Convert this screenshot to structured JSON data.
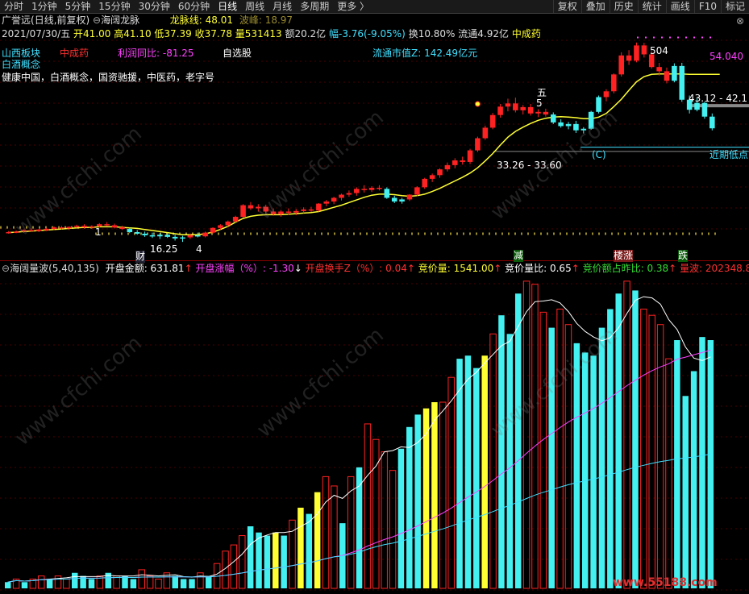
{
  "toolbar": {
    "periods": [
      "分时",
      "1分钟",
      "5分钟",
      "15分钟",
      "30分钟",
      "60分钟",
      "日线",
      "周线",
      "月线",
      "多周期",
      "更多 〉"
    ],
    "active": "日线",
    "right": [
      "复权",
      "叠加",
      "历史",
      "统计",
      "画线",
      "F10",
      "标记"
    ]
  },
  "header": {
    "stock_name": "广誉远",
    "mode": "(日线,前复权)",
    "indicator_name": "海阔龙脉",
    "longmai_label": "龙脉线:",
    "longmai_value": "48.01",
    "bofeng_label": "波峰:",
    "bofeng_value": "18.97"
  },
  "quote": {
    "date": "2021/07/30/五",
    "open": "开41.00",
    "high": "高41.10",
    "low": "低37.39",
    "close": "收37.78",
    "volume": "量531413",
    "amount": "额20.2亿",
    "change": "幅-3.76(-9.05%)",
    "turnover": "换10.80%",
    "float": "流通4.92亿",
    "industry": "中成药"
  },
  "info": {
    "region": "山西板块",
    "industry": "中成药",
    "profit_label": "利润同比: -81.25",
    "watchlist": "自选股",
    "market_cap": "流通市值Z: 142.49亿元",
    "concept": "白酒概念",
    "tags": "健康中国，白酒概念，国资驰援，中医药，老字号"
  },
  "annotations": {
    "price_high": "54.040",
    "range1": "43.12 - 42.1",
    "range2": "33.26 - 33.60",
    "low_price": "16.25",
    "recent_low": "近期低点",
    "wu": "五",
    "five": "5",
    "c_mark": "(C)",
    "cai": "财",
    "one": "1",
    "four": "4",
    "peak_text": "5",
    "peak_text2": "04",
    "jian": "减",
    "lou": "楼涨",
    "die": "跌"
  },
  "sub": {
    "name": "海阔量波(5,40,135)",
    "kaipan_jine": "开盘金额: 631.81",
    "zhangfu": "开盘涨幅（%）: -1.30",
    "huanshou": "开盘换手Z（%）: 0.04",
    "jingjia_liang": "竞价量: 1541.00",
    "liangbi": "竞价量比: 0.65",
    "jine_zhanbi": "竞价额占昨比: 0.38",
    "liangbo": "量波: 202348.80"
  },
  "watermark": "www.cfchi.com",
  "corner_logo": "www.55188.com",
  "colors": {
    "up": "#ff2222",
    "down": "#44f0f0",
    "ma": "#ffff33",
    "pink": "#ff40ff",
    "cyan": "#40e0ff"
  },
  "chart_data": {
    "type": "candlestick",
    "candles": [
      [
        18.0,
        18.3,
        17.8,
        18.1,
        0
      ],
      [
        18.1,
        18.4,
        17.9,
        18.2,
        0
      ],
      [
        18.2,
        18.6,
        18.0,
        18.5,
        0
      ],
      [
        18.5,
        18.8,
        18.2,
        18.3,
        0
      ],
      [
        18.3,
        18.7,
        18.1,
        18.6,
        0
      ],
      [
        18.6,
        18.9,
        18.3,
        18.7,
        0
      ],
      [
        18.7,
        19.2,
        18.5,
        19.0,
        0
      ],
      [
        19.0,
        19.3,
        18.6,
        18.8,
        0
      ],
      [
        18.8,
        19.2,
        18.5,
        19.1,
        0
      ],
      [
        19.1,
        19.5,
        18.9,
        19.3,
        0
      ],
      [
        19.3,
        19.6,
        18.8,
        19.0,
        0
      ],
      [
        19.0,
        19.4,
        18.7,
        19.2,
        0
      ],
      [
        19.2,
        19.8,
        19.0,
        19.6,
        0
      ],
      [
        19.6,
        20.0,
        19.2,
        19.4,
        0
      ],
      [
        19.4,
        19.7,
        18.8,
        19.0,
        0
      ],
      [
        19.0,
        19.3,
        18.5,
        18.7,
        0
      ],
      [
        18.7,
        19.0,
        17.9,
        18.1,
        1
      ],
      [
        18.1,
        18.5,
        17.6,
        17.8,
        1
      ],
      [
        17.8,
        18.2,
        17.2,
        17.5,
        1
      ],
      [
        17.5,
        18.0,
        17.0,
        17.3,
        1
      ],
      [
        17.3,
        17.9,
        16.8,
        17.6,
        1
      ],
      [
        17.6,
        18.0,
        17.0,
        17.2,
        1
      ],
      [
        17.2,
        17.6,
        16.5,
        16.9,
        1
      ],
      [
        16.9,
        17.4,
        16.25,
        17.1,
        1
      ],
      [
        17.1,
        17.8,
        16.8,
        17.5,
        0
      ],
      [
        17.5,
        18.0,
        17.1,
        17.3,
        1
      ],
      [
        17.3,
        18.2,
        17.1,
        18.0,
        0
      ],
      [
        18.0,
        19.0,
        17.8,
        18.9,
        0
      ],
      [
        18.9,
        19.6,
        18.6,
        19.4,
        0
      ],
      [
        19.4,
        20.3,
        19.0,
        20.1,
        0
      ],
      [
        20.1,
        21.2,
        19.9,
        21.0,
        0
      ],
      [
        21.0,
        23.4,
        20.8,
        23.2,
        0
      ],
      [
        23.2,
        23.8,
        22.3,
        22.6,
        0
      ],
      [
        22.6,
        23.4,
        22.0,
        22.9,
        0
      ],
      [
        22.9,
        23.3,
        21.6,
        22.0,
        0
      ],
      [
        22.0,
        22.6,
        21.2,
        21.5,
        0
      ],
      [
        21.5,
        22.3,
        21.0,
        22.0,
        0
      ],
      [
        22.0,
        22.6,
        21.4,
        21.8,
        0
      ],
      [
        21.8,
        22.5,
        21.3,
        22.1,
        0
      ],
      [
        22.1,
        22.8,
        21.7,
        22.4,
        0
      ],
      [
        22.4,
        22.9,
        21.9,
        22.2,
        0
      ],
      [
        22.2,
        23.6,
        22.0,
        23.5,
        0
      ],
      [
        23.5,
        24.2,
        23.0,
        23.9,
        0
      ],
      [
        23.9,
        24.8,
        23.4,
        24.6,
        0
      ],
      [
        24.6,
        25.4,
        24.1,
        25.2,
        0
      ],
      [
        25.2,
        26.0,
        24.8,
        25.5,
        0
      ],
      [
        25.5,
        26.6,
        25.0,
        26.3,
        0
      ],
      [
        26.3,
        27.0,
        25.6,
        26.1,
        0
      ],
      [
        26.1,
        26.8,
        25.7,
        26.5,
        0
      ],
      [
        26.5,
        27.0,
        26.0,
        26.3,
        0
      ],
      [
        26.3,
        26.6,
        24.4,
        24.6,
        1
      ],
      [
        24.6,
        25.0,
        23.6,
        23.9,
        1
      ],
      [
        23.9,
        24.6,
        23.5,
        24.3,
        1
      ],
      [
        24.3,
        25.3,
        24.0,
        25.2,
        0
      ],
      [
        25.2,
        26.8,
        24.9,
        26.6,
        0
      ],
      [
        26.6,
        28.4,
        26.3,
        28.2,
        0
      ],
      [
        28.2,
        29.2,
        27.6,
        28.9,
        0
      ],
      [
        28.9,
        30.2,
        28.4,
        30.0,
        0
      ],
      [
        30.0,
        31.3,
        29.6,
        30.8,
        0
      ],
      [
        30.8,
        32.1,
        30.2,
        31.7,
        0
      ],
      [
        31.7,
        32.4,
        30.9,
        31.4,
        0
      ],
      [
        31.4,
        33.9,
        31.0,
        33.6,
        0
      ],
      [
        33.6,
        36.2,
        33.3,
        35.9,
        0
      ],
      [
        35.9,
        38.3,
        35.6,
        37.9,
        0
      ],
      [
        37.9,
        40.7,
        37.6,
        40.3,
        0
      ],
      [
        40.3,
        42.4,
        39.8,
        41.9,
        0
      ],
      [
        41.9,
        43.4,
        41.0,
        42.5,
        0
      ],
      [
        42.5,
        43.6,
        40.8,
        41.2,
        0
      ],
      [
        41.2,
        42.2,
        40.4,
        41.8,
        0
      ],
      [
        41.8,
        42.4,
        40.2,
        40.6,
        0
      ],
      [
        40.6,
        41.4,
        39.9,
        40.9,
        0
      ],
      [
        40.9,
        41.5,
        40.0,
        40.4,
        0
      ],
      [
        40.4,
        40.8,
        38.6,
        38.9,
        1
      ],
      [
        38.9,
        39.5,
        37.9,
        38.2,
        1
      ],
      [
        38.2,
        39.0,
        37.6,
        38.6,
        1
      ],
      [
        38.6,
        39.2,
        36.9,
        37.4,
        1
      ],
      [
        37.4,
        38.0,
        36.8,
        37.7,
        1
      ],
      [
        37.7,
        41.1,
        37.5,
        40.9,
        1
      ],
      [
        40.9,
        44.0,
        40.6,
        43.7,
        1
      ],
      [
        43.7,
        45.2,
        42.9,
        44.8,
        0
      ],
      [
        44.8,
        48.2,
        44.4,
        48.0,
        0
      ],
      [
        48.0,
        52.2,
        47.6,
        51.6,
        0
      ],
      [
        51.6,
        52.6,
        49.8,
        50.6,
        0
      ],
      [
        50.6,
        54.04,
        50.3,
        53.5,
        0
      ],
      [
        53.5,
        54.0,
        51.2,
        51.8,
        0
      ],
      [
        51.8,
        52.4,
        49.1,
        49.4,
        0
      ],
      [
        49.4,
        50.2,
        47.8,
        48.6,
        0
      ],
      [
        48.6,
        49.3,
        46.3,
        46.8,
        0
      ],
      [
        46.8,
        50.1,
        46.5,
        49.6,
        1
      ],
      [
        49.6,
        50.2,
        42.8,
        43.2,
        1
      ],
      [
        43.2,
        44.0,
        40.6,
        41.3,
        1
      ],
      [
        41.3,
        43.5,
        41.0,
        42.6,
        1
      ],
      [
        42.6,
        42.8,
        39.6,
        40.0,
        1
      ],
      [
        40.0,
        40.6,
        37.39,
        37.78,
        1
      ]
    ],
    "price_range": [
      15.5,
      56.0
    ],
    "ma_line": [
      18.0,
      18.1,
      18.2,
      18.3,
      18.4,
      18.5,
      18.6,
      18.7,
      18.8,
      18.9,
      19.0,
      19.0,
      19.1,
      19.1,
      19.1,
      19.0,
      18.9,
      18.8,
      18.6,
      18.4,
      18.2,
      18.0,
      17.8,
      17.6,
      17.6,
      17.6,
      17.8,
      18.1,
      18.6,
      19.2,
      20.0,
      20.7,
      21.1,
      21.3,
      21.4,
      21.4,
      21.4,
      21.5,
      21.6,
      21.7,
      21.8,
      22.0,
      22.4,
      22.8,
      23.2,
      23.7,
      24.2,
      24.7,
      25.1,
      25.3,
      25.3,
      25.2,
      25.0,
      24.9,
      25.0,
      25.3,
      25.8,
      26.4,
      27.1,
      27.8,
      28.5,
      29.3,
      30.3,
      31.6,
      33.0,
      34.6,
      36.1,
      37.2,
      38.0,
      38.7,
      39.3,
      39.7,
      39.9,
      40.0,
      39.9,
      39.8,
      39.6,
      39.6,
      39.9,
      40.6,
      41.9,
      43.3,
      45.0,
      46.6,
      47.6,
      48.0,
      48.1,
      48.1,
      48.1,
      48.1,
      48.0,
      48.0,
      48.0,
      48.0,
      48.01
    ],
    "volume_bars": [
      [
        2,
        1
      ],
      [
        3,
        0
      ],
      [
        2,
        1
      ],
      [
        3,
        0
      ],
      [
        4,
        0
      ],
      [
        3,
        1
      ],
      [
        4,
        0
      ],
      [
        3,
        0
      ],
      [
        5,
        1
      ],
      [
        4,
        1
      ],
      [
        3,
        1
      ],
      [
        4,
        0
      ],
      [
        5,
        1
      ],
      [
        4,
        0
      ],
      [
        4,
        1
      ],
      [
        3,
        1
      ],
      [
        6,
        0
      ],
      [
        4,
        0
      ],
      [
        3,
        0
      ],
      [
        5,
        0
      ],
      [
        4,
        1
      ],
      [
        3,
        1
      ],
      [
        3,
        1
      ],
      [
        5,
        0
      ],
      [
        4,
        1
      ],
      [
        8,
        0
      ],
      [
        12,
        0
      ],
      [
        14,
        0
      ],
      [
        17,
        0
      ],
      [
        20,
        1
      ],
      [
        18,
        1
      ],
      [
        17,
        1
      ],
      [
        18,
        2
      ],
      [
        17,
        1
      ],
      [
        22,
        0
      ],
      [
        26,
        2
      ],
      [
        24,
        1
      ],
      [
        31,
        2
      ],
      [
        36,
        0
      ],
      [
        33,
        0
      ],
      [
        21,
        1
      ],
      [
        36,
        0
      ],
      [
        39,
        1
      ],
      [
        53,
        0
      ],
      [
        48,
        0
      ],
      [
        44,
        0
      ],
      [
        38,
        0
      ],
      [
        45,
        1
      ],
      [
        52,
        1
      ],
      [
        56,
        1
      ],
      [
        58,
        2
      ],
      [
        60,
        2
      ],
      [
        60,
        0
      ],
      [
        68,
        0
      ],
      [
        74,
        1
      ],
      [
        75,
        1
      ],
      [
        71,
        1
      ],
      [
        75,
        2
      ],
      [
        82,
        0
      ],
      [
        88,
        1
      ],
      [
        82,
        1
      ],
      [
        95,
        1
      ],
      [
        99,
        0
      ],
      [
        98,
        0
      ],
      [
        89,
        0
      ],
      [
        84,
        1
      ],
      [
        90,
        0
      ],
      [
        85,
        0
      ],
      [
        79,
        1
      ],
      [
        76,
        1
      ],
      [
        75,
        1
      ],
      [
        84,
        1
      ],
      [
        90,
        1
      ],
      [
        95,
        1
      ],
      [
        99,
        0
      ],
      [
        96,
        1
      ],
      [
        90,
        0
      ],
      [
        88,
        0
      ],
      [
        85,
        0
      ],
      [
        74,
        0
      ],
      [
        80,
        1
      ],
      [
        62,
        1
      ],
      [
        70,
        1
      ],
      [
        81,
        1
      ],
      [
        80,
        1
      ]
    ]
  }
}
